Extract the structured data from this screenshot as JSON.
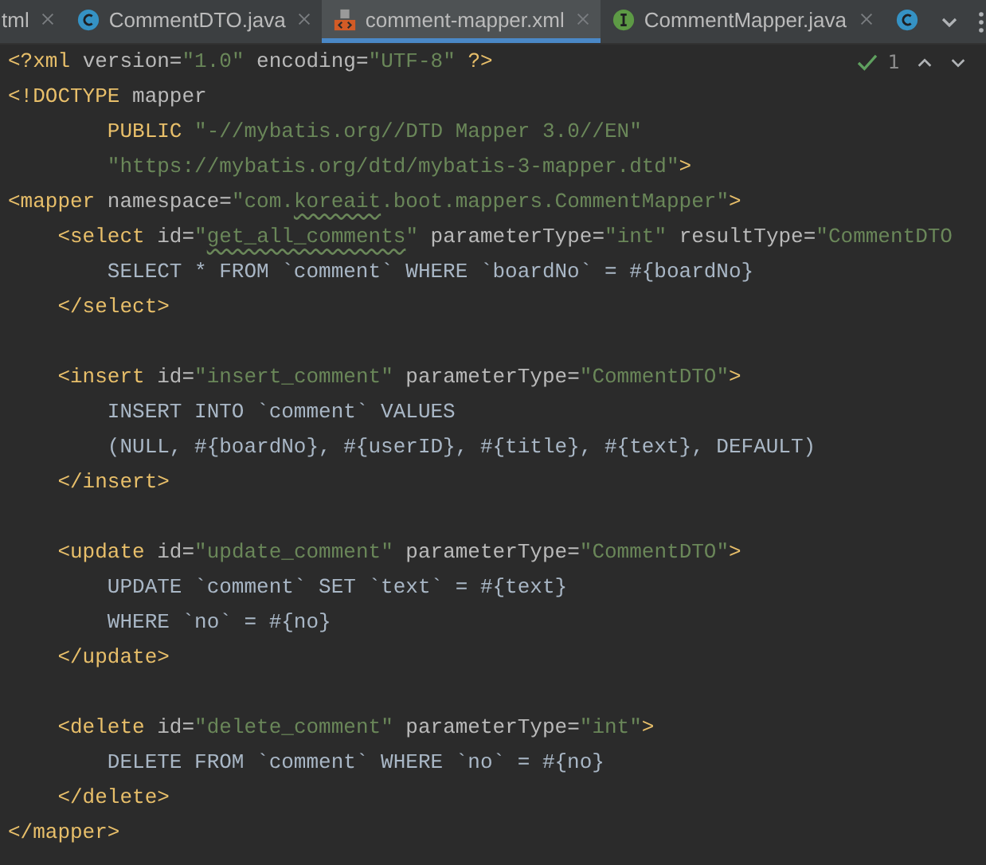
{
  "tabs": [
    {
      "label": "tml",
      "kind": "plain",
      "selected": false
    },
    {
      "label": "CommentDTO.java",
      "kind": "class",
      "selected": false
    },
    {
      "label": "comment-mapper.xml",
      "kind": "xml",
      "selected": true
    },
    {
      "label": "CommentMapper.java",
      "kind": "interface",
      "selected": false
    },
    {
      "kind": "class",
      "selected": false
    }
  ],
  "inspection": {
    "count": "1"
  },
  "lines": [
    {
      "kind": "code",
      "tokens": [
        {
          "t": "<?xml ",
          "kind": "tag"
        },
        {
          "t": "version",
          "kind": "attr"
        },
        {
          "t": "=",
          "kind": "attr"
        },
        {
          "t": "\"1.0\" ",
          "kind": "str"
        },
        {
          "t": "encoding",
          "kind": "attr"
        },
        {
          "t": "=",
          "kind": "attr"
        },
        {
          "t": "\"UTF-8\" ",
          "kind": "str"
        },
        {
          "t": "?>",
          "kind": "tag"
        }
      ]
    },
    {
      "kind": "code",
      "tokens": [
        {
          "t": "<!DOCTYPE ",
          "kind": "tag"
        },
        {
          "t": "mapper",
          "kind": "attr"
        }
      ]
    },
    {
      "kind": "code",
      "tokens": [
        {
          "t": "        PUBLIC ",
          "kind": "tag"
        },
        {
          "t": "\"-//mybatis.org//DTD Mapper 3.0//EN\"",
          "kind": "str"
        }
      ]
    },
    {
      "kind": "code",
      "tokens": [
        {
          "t": "        \"https://mybatis.org/dtd/mybatis-3-mapper.dtd\"",
          "kind": "str"
        },
        {
          "t": ">",
          "kind": "tag"
        }
      ]
    },
    {
      "kind": "code",
      "tokens": [
        {
          "t": "<mapper ",
          "kind": "tag"
        },
        {
          "t": "namespace",
          "kind": "attr"
        },
        {
          "t": "=",
          "kind": "attr"
        },
        {
          "t": "\"com.",
          "kind": "str"
        },
        {
          "t": "koreait",
          "kind": "str",
          "typo": true
        },
        {
          "t": ".boot.mappers.CommentMapper\"",
          "kind": "str"
        },
        {
          "t": ">",
          "kind": "tag"
        }
      ]
    },
    {
      "kind": "code",
      "tokens": [
        {
          "t": "    <select ",
          "kind": "tag"
        },
        {
          "t": "id",
          "kind": "attr"
        },
        {
          "t": "=",
          "kind": "attr"
        },
        {
          "t": "\"",
          "kind": "str"
        },
        {
          "t": "get_all_comments",
          "kind": "str",
          "typo": true
        },
        {
          "t": "\" ",
          "kind": "str"
        },
        {
          "t": "parameterType",
          "kind": "attr"
        },
        {
          "t": "=",
          "kind": "attr"
        },
        {
          "t": "\"int\" ",
          "kind": "str"
        },
        {
          "t": "resultType",
          "kind": "attr"
        },
        {
          "t": "=",
          "kind": "attr"
        },
        {
          "t": "\"CommentDTO",
          "kind": "str"
        }
      ]
    },
    {
      "kind": "code",
      "tokens": [
        {
          "t": "        SELECT * FROM `comment` WHERE `boardNo` = #{boardNo}",
          "kind": "sql"
        }
      ]
    },
    {
      "kind": "code",
      "tokens": [
        {
          "t": "    </select>",
          "kind": "tag"
        }
      ]
    },
    {
      "kind": "blank"
    },
    {
      "kind": "code",
      "tokens": [
        {
          "t": "    <insert ",
          "kind": "tag"
        },
        {
          "t": "id",
          "kind": "attr"
        },
        {
          "t": "=",
          "kind": "attr"
        },
        {
          "t": "\"insert_comment\" ",
          "kind": "str"
        },
        {
          "t": "parameterType",
          "kind": "attr"
        },
        {
          "t": "=",
          "kind": "attr"
        },
        {
          "t": "\"CommentDTO\"",
          "kind": "str"
        },
        {
          "t": ">",
          "kind": "tag"
        }
      ]
    },
    {
      "kind": "code",
      "tokens": [
        {
          "t": "        INSERT INTO `comment` VALUES",
          "kind": "sql"
        }
      ]
    },
    {
      "kind": "code",
      "tokens": [
        {
          "t": "        (NULL, #{boardNo}, #{userID}, #{title}, #{text}, DEFAULT)",
          "kind": "sql"
        }
      ]
    },
    {
      "kind": "code",
      "tokens": [
        {
          "t": "    </insert>",
          "kind": "tag"
        }
      ]
    },
    {
      "kind": "blank"
    },
    {
      "kind": "code",
      "tokens": [
        {
          "t": "    <update ",
          "kind": "tag"
        },
        {
          "t": "id",
          "kind": "attr"
        },
        {
          "t": "=",
          "kind": "attr"
        },
        {
          "t": "\"update_comment\" ",
          "kind": "str"
        },
        {
          "t": "parameterType",
          "kind": "attr"
        },
        {
          "t": "=",
          "kind": "attr"
        },
        {
          "t": "\"CommentDTO\"",
          "kind": "str"
        },
        {
          "t": ">",
          "kind": "tag"
        }
      ]
    },
    {
      "kind": "code",
      "tokens": [
        {
          "t": "        UPDATE `comment` SET `text` = #{text}",
          "kind": "sql"
        }
      ]
    },
    {
      "kind": "code",
      "tokens": [
        {
          "t": "        WHERE `no` = #{no}",
          "kind": "sql"
        }
      ]
    },
    {
      "kind": "code",
      "tokens": [
        {
          "t": "    </update>",
          "kind": "tag"
        }
      ]
    },
    {
      "kind": "blank"
    },
    {
      "kind": "code",
      "tokens": [
        {
          "t": "    <delete ",
          "kind": "tag"
        },
        {
          "t": "id",
          "kind": "attr"
        },
        {
          "t": "=",
          "kind": "attr"
        },
        {
          "t": "\"delete_comment\" ",
          "kind": "str"
        },
        {
          "t": "parameterType",
          "kind": "attr"
        },
        {
          "t": "=",
          "kind": "attr"
        },
        {
          "t": "\"int\"",
          "kind": "str"
        },
        {
          "t": ">",
          "kind": "tag"
        }
      ]
    },
    {
      "kind": "code",
      "tokens": [
        {
          "t": "        DELETE FROM `comment` WHERE `no` = #{no}",
          "kind": "sql"
        }
      ]
    },
    {
      "kind": "code",
      "tokens": [
        {
          "t": "    </delete>",
          "kind": "tag"
        }
      ]
    },
    {
      "kind": "code",
      "tokens": [
        {
          "t": "</mapper>",
          "kind": "tag"
        }
      ]
    }
  ]
}
